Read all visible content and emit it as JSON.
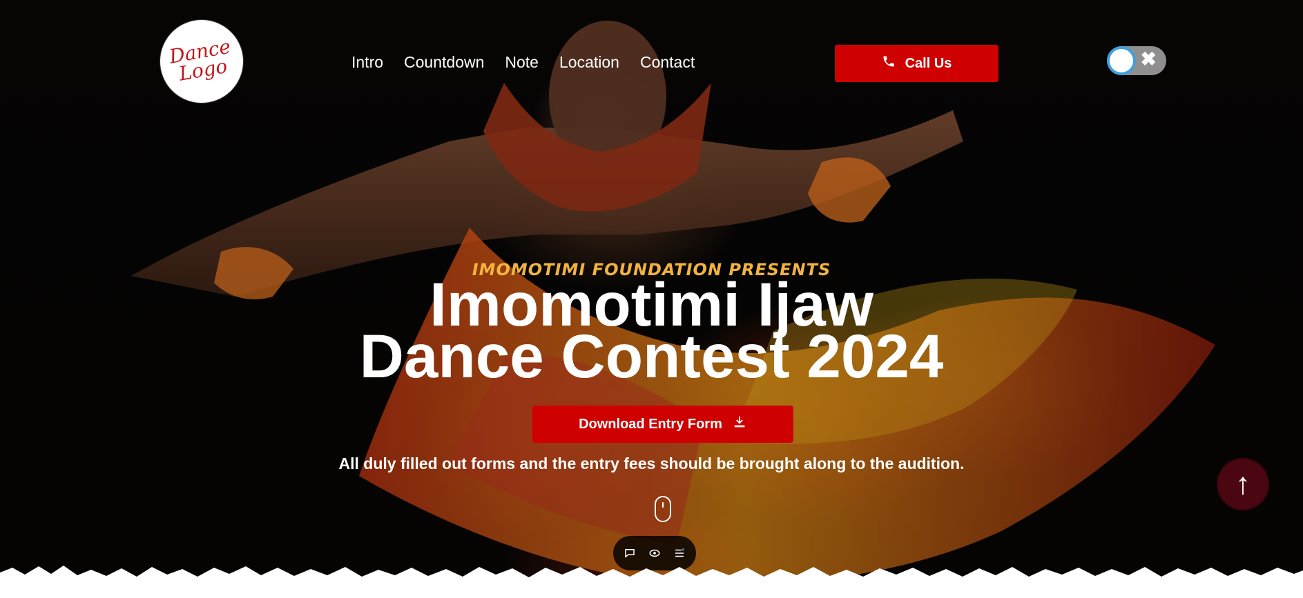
{
  "brand": {
    "logo_line1": "Dance",
    "logo_line2": "Logo"
  },
  "nav": {
    "items": [
      {
        "label": "Intro"
      },
      {
        "label": "Countdown"
      },
      {
        "label": "Note"
      },
      {
        "label": "Location"
      },
      {
        "label": "Contact"
      }
    ]
  },
  "header": {
    "call_label": "Call Us",
    "call_icon": "phone-icon",
    "toggle_icon": "close-icon"
  },
  "hero": {
    "presents": "IMOMOTIMI FOUNDATION PRESENTS",
    "title_line1": "Imomotimi Ijaw",
    "title_line2": "Dance Contest 2024",
    "download_label": "Download Entry Form",
    "download_icon": "download-icon",
    "notice": "All duly filled out forms and the entry fees should be brought along to the audition.",
    "scroll_icon": "mouse-icon"
  },
  "floating": {
    "back_to_top_icon": "arrow-up-icon",
    "toolbar_icons": [
      "chat-icon",
      "eye-icon",
      "menu-icon"
    ]
  },
  "colors": {
    "accent_red": "#cf0000",
    "presents_gold": "#f2b43f",
    "back_to_top": "#4a0711",
    "toggle_blue": "#3fa0dd"
  }
}
